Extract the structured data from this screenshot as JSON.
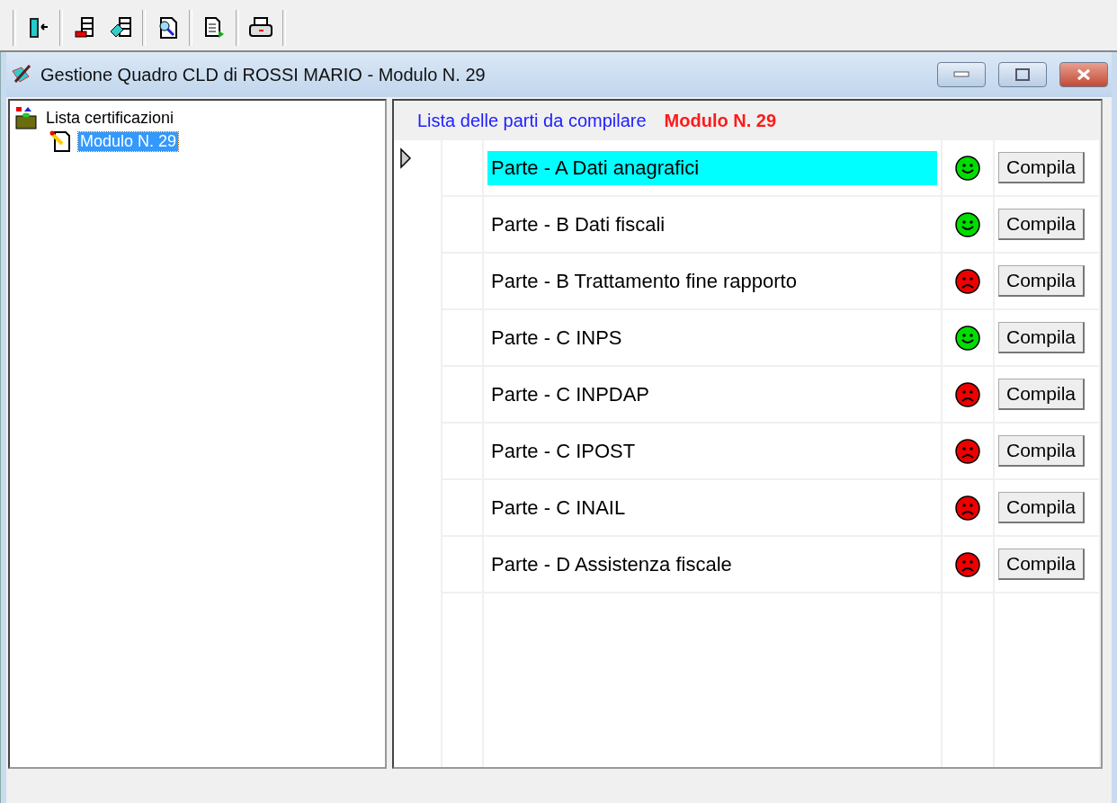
{
  "toolbar": {
    "buttons": [
      {
        "kind": "exit"
      },
      {
        "kind": "sep"
      },
      {
        "kind": "list"
      },
      {
        "kind": "edit"
      },
      {
        "kind": "sep"
      },
      {
        "kind": "search"
      },
      {
        "kind": "sep"
      },
      {
        "kind": "export"
      },
      {
        "kind": "sep"
      },
      {
        "kind": "print"
      },
      {
        "kind": "sep"
      }
    ]
  },
  "window": {
    "title": "Gestione Quadro CLD di ROSSI MARIO - Modulo N. 29"
  },
  "tree": {
    "items": [
      {
        "label": "Lista certificazioni",
        "selected": false,
        "children": [
          {
            "label": "Modulo N. 29",
            "selected": true
          }
        ]
      }
    ]
  },
  "panel": {
    "heading": "Lista delle parti da compilare",
    "module": "Modulo N. 29"
  },
  "rows": [
    {
      "name": "Parte - A Dati anagrafici",
      "selected": true,
      "complete": true,
      "button": "Compila"
    },
    {
      "name": "Parte - B Dati fiscali",
      "selected": false,
      "complete": true,
      "button": "Compila"
    },
    {
      "name": "Parte - B Trattamento fine rapporto",
      "selected": false,
      "complete": false,
      "button": "Compila"
    },
    {
      "name": "Parte - C INPS",
      "selected": false,
      "complete": true,
      "button": "Compila"
    },
    {
      "name": "Parte - C INPDAP",
      "selected": false,
      "complete": false,
      "button": "Compila"
    },
    {
      "name": "Parte - C IPOST",
      "selected": false,
      "complete": false,
      "button": "Compila"
    },
    {
      "name": "Parte - C INAIL",
      "selected": false,
      "complete": false,
      "button": "Compila"
    },
    {
      "name": "Parte - D Assistenza fiscale",
      "selected": false,
      "complete": false,
      "button": "Compila"
    }
  ]
}
